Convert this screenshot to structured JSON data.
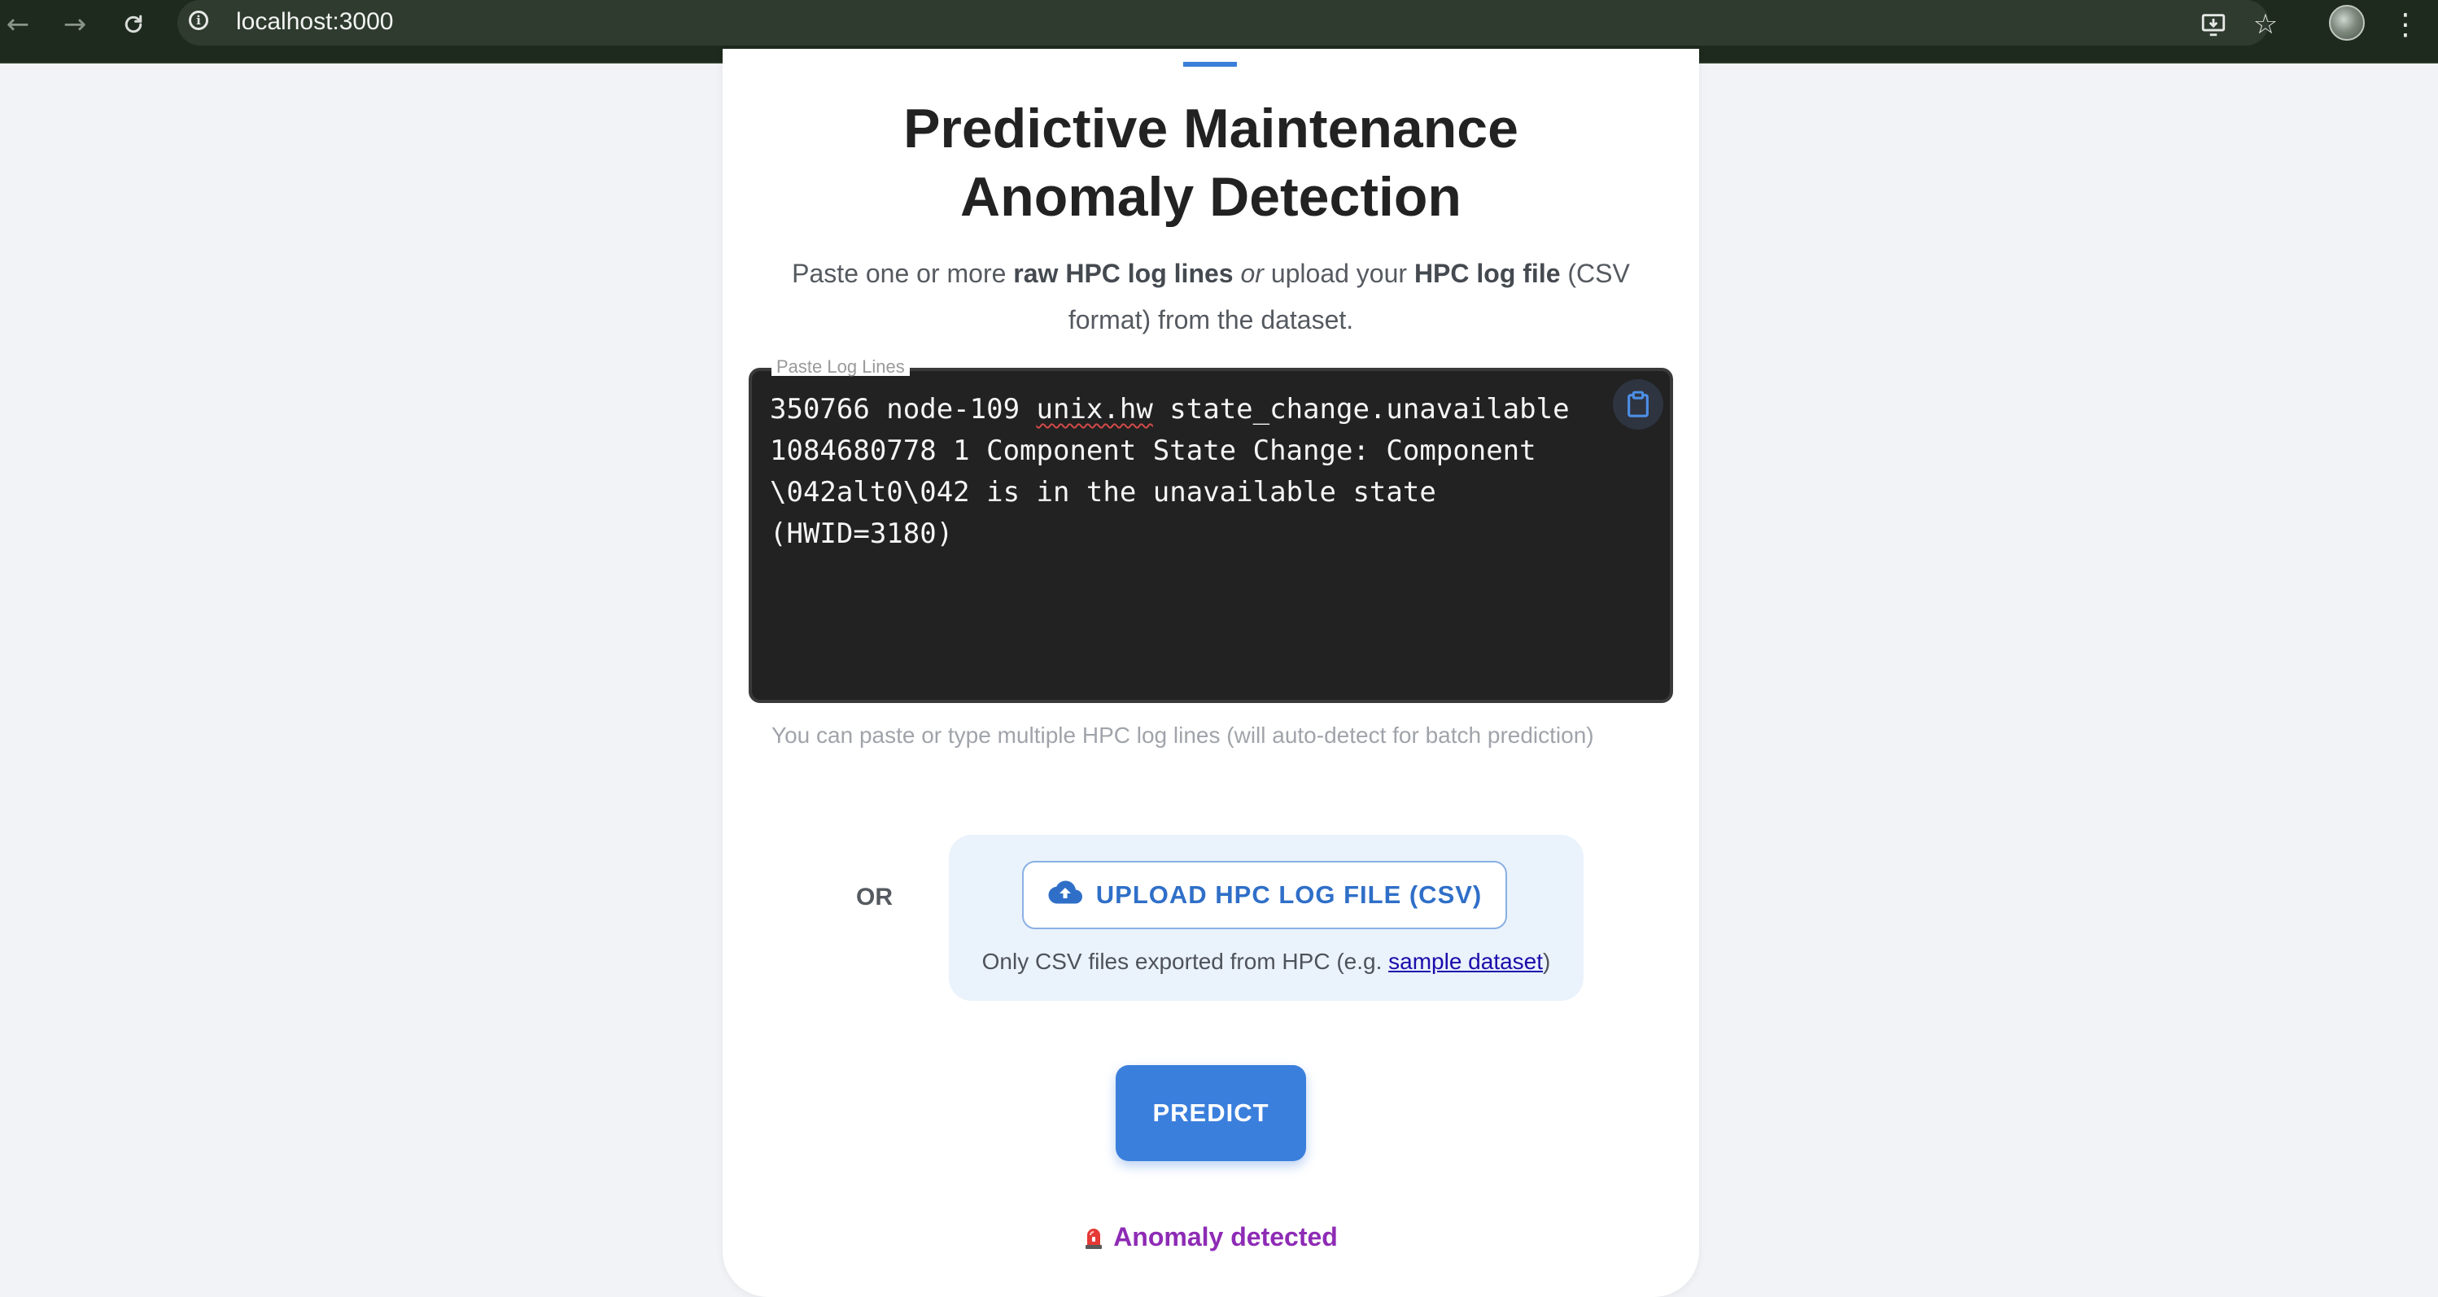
{
  "browser": {
    "url": "localhost:3000",
    "nav": {
      "back_icon": "back-arrow-icon",
      "forward_icon": "forward-arrow-icon",
      "reload_icon": "reload-icon"
    }
  },
  "header": {
    "title_line1": "Predictive Maintenance",
    "title_line2": "Anomaly Detection"
  },
  "intro": {
    "part1": "Paste one or more ",
    "bold1": "raw HPC log lines",
    "italic": " or ",
    "part2": "upload your ",
    "bold2": "HPC log file",
    "part3": " (CSV format) from the dataset."
  },
  "log_input": {
    "label": "Paste Log Lines",
    "value_before": "350766 node-109 ",
    "value_flagged": "unix.hw",
    "value_after": " state_change.unavailable 1084680778 1 Component State Change: Component \\042alt0\\042 is in the unavailable state (HWID=3180)",
    "helper": "You can paste or type multiple HPC log lines (will auto-detect for batch prediction)",
    "paste_icon": "clipboard-icon"
  },
  "upload": {
    "or_label": "OR",
    "button_label": "UPLOAD HPC LOG FILE (CSV)",
    "button_icon": "cloud-upload-icon",
    "note_before": "Only CSV files exported from HPC (e.g. ",
    "note_link": "sample dataset",
    "note_after": ")"
  },
  "actions": {
    "predict_label": "PREDICT"
  },
  "result": {
    "icon": "alarm-siren-icon",
    "text": "Anomaly detected",
    "color": "#8e2bb5"
  },
  "colors": {
    "accent": "#3b7fdc",
    "page_bg": "#f1f3f7",
    "chrome_bg": "#1e2a1e"
  }
}
